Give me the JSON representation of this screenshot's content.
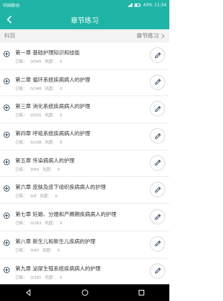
{
  "status_bar": {
    "carrier": "中国移动",
    "battery": "43%",
    "time": "11:54"
  },
  "header": {
    "title": "章节练习"
  },
  "subject": {
    "label": "科目",
    "value": "章节练习"
  },
  "stats_labels": {
    "done": "已练：",
    "correct": "巩固："
  },
  "chapters": [
    {
      "name": "第一章  基础护理知识和技能",
      "done": "0/545",
      "correct": "0"
    },
    {
      "name": "第二章  循环系统疾病病人的护理",
      "done": "0/248",
      "correct": "0"
    },
    {
      "name": "第三章  消化系统疾病病人的护理",
      "done": "0/501",
      "correct": "0"
    },
    {
      "name": "第四章  呼吸系统疾病病人的护理",
      "done": "0/238",
      "correct": "0"
    },
    {
      "name": "第五章  传染病病人的护理",
      "done": "0/69",
      "correct": "0"
    },
    {
      "name": "第六章  皮肤及皮下组织疾病病人的护理",
      "done": "0/8",
      "correct": "0"
    },
    {
      "name": "第七章  妊娠、分娩和产褥期疾病病人的护理",
      "done": "0/283",
      "correct": "0"
    },
    {
      "name": "第八章  新生儿和新生儿疾病的护理",
      "done": "0/43",
      "correct": "0"
    },
    {
      "name": "第九章  泌尿生殖系统疾病病人的护理",
      "done": "0/181",
      "correct": "0"
    }
  ],
  "colors": {
    "accent": "#1fb5a6",
    "icon": "#2a3f55"
  }
}
